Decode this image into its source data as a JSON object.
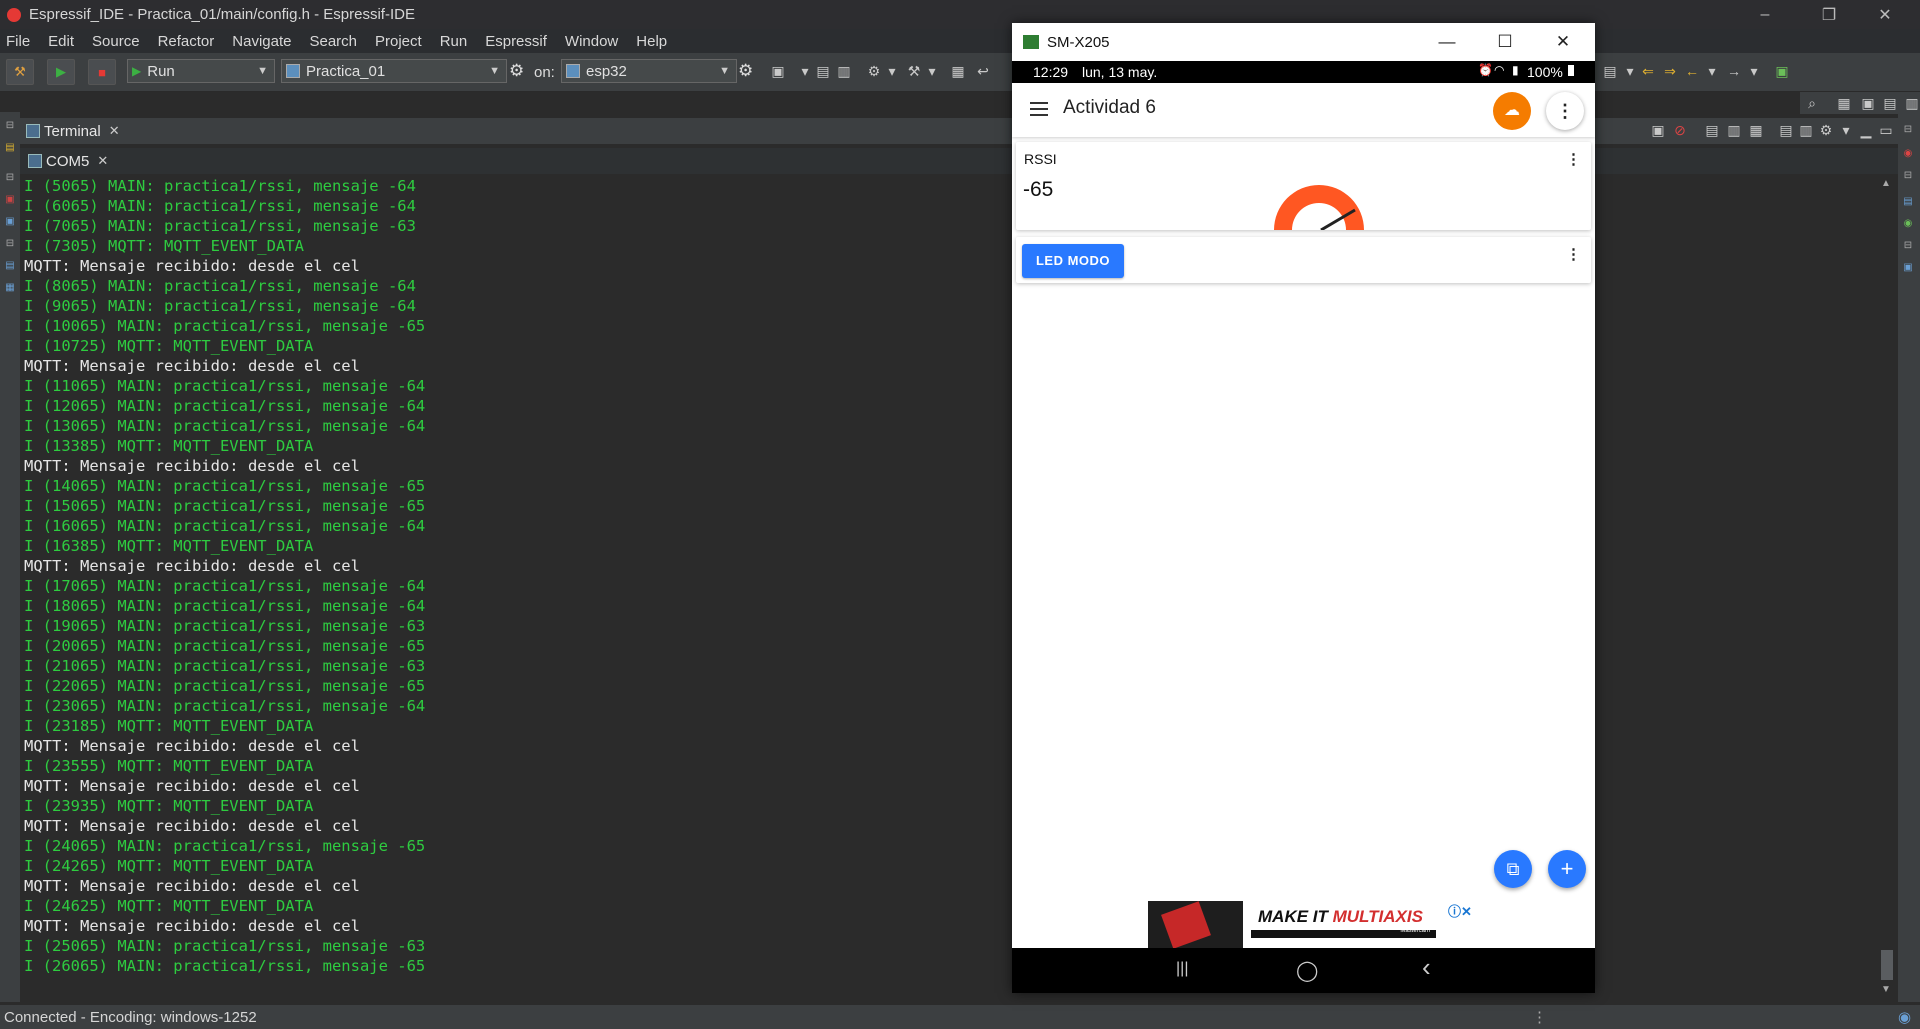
{
  "window": {
    "title": "Espressif_IDE - Practica_01/main/config.h - Espressif-IDE",
    "minimize": "–",
    "maximize": "❐",
    "close": "✕"
  },
  "menu": [
    "File",
    "Edit",
    "Source",
    "Refactor",
    "Navigate",
    "Search",
    "Project",
    "Run",
    "Espressif",
    "Window",
    "Help"
  ],
  "toolbar": {
    "launch_mode": "Run",
    "launch_config": "Practica_01",
    "on_label": "on:",
    "target": "esp32"
  },
  "tabs": {
    "terminal": "Terminal",
    "com": "COM5"
  },
  "console": [
    {
      "text": "I (5065) MAIN: practica1/rssi, mensaje -64",
      "c": "g"
    },
    {
      "text": "I (6065) MAIN: practica1/rssi, mensaje -64",
      "c": "g"
    },
    {
      "text": "I (7065) MAIN: practica1/rssi, mensaje -63",
      "c": "g"
    },
    {
      "text": "I (7305) MQTT: MQTT_EVENT_DATA",
      "c": "g"
    },
    {
      "text": "MQTT: Mensaje recibido: desde el cel",
      "c": "w"
    },
    {
      "text": "I (8065) MAIN: practica1/rssi, mensaje -64",
      "c": "g"
    },
    {
      "text": "I (9065) MAIN: practica1/rssi, mensaje -64",
      "c": "g"
    },
    {
      "text": "I (10065) MAIN: practica1/rssi, mensaje -65",
      "c": "g"
    },
    {
      "text": "I (10725) MQTT: MQTT_EVENT_DATA",
      "c": "g"
    },
    {
      "text": "MQTT: Mensaje recibido: desde el cel",
      "c": "w"
    },
    {
      "text": "I (11065) MAIN: practica1/rssi, mensaje -64",
      "c": "g"
    },
    {
      "text": "I (12065) MAIN: practica1/rssi, mensaje -64",
      "c": "g"
    },
    {
      "text": "I (13065) MAIN: practica1/rssi, mensaje -64",
      "c": "g"
    },
    {
      "text": "I (13385) MQTT: MQTT_EVENT_DATA",
      "c": "g"
    },
    {
      "text": "MQTT: Mensaje recibido: desde el cel",
      "c": "w"
    },
    {
      "text": "I (14065) MAIN: practica1/rssi, mensaje -65",
      "c": "g"
    },
    {
      "text": "I (15065) MAIN: practica1/rssi, mensaje -65",
      "c": "g"
    },
    {
      "text": "I (16065) MAIN: practica1/rssi, mensaje -64",
      "c": "g"
    },
    {
      "text": "I (16385) MQTT: MQTT_EVENT_DATA",
      "c": "g"
    },
    {
      "text": "MQTT: Mensaje recibido: desde el cel",
      "c": "w"
    },
    {
      "text": "I (17065) MAIN: practica1/rssi, mensaje -64",
      "c": "g"
    },
    {
      "text": "I (18065) MAIN: practica1/rssi, mensaje -64",
      "c": "g"
    },
    {
      "text": "I (19065) MAIN: practica1/rssi, mensaje -63",
      "c": "g"
    },
    {
      "text": "I (20065) MAIN: practica1/rssi, mensaje -65",
      "c": "g"
    },
    {
      "text": "I (21065) MAIN: practica1/rssi, mensaje -63",
      "c": "g"
    },
    {
      "text": "I (22065) MAIN: practica1/rssi, mensaje -65",
      "c": "g"
    },
    {
      "text": "I (23065) MAIN: practica1/rssi, mensaje -64",
      "c": "g"
    },
    {
      "text": "I (23185) MQTT: MQTT_EVENT_DATA",
      "c": "g"
    },
    {
      "text": "MQTT: Mensaje recibido: desde el cel",
      "c": "w"
    },
    {
      "text": "I (23555) MQTT: MQTT_EVENT_DATA",
      "c": "g"
    },
    {
      "text": "MQTT: Mensaje recibido: desde el cel",
      "c": "w"
    },
    {
      "text": "I (23935) MQTT: MQTT_EVENT_DATA",
      "c": "g"
    },
    {
      "text": "MQTT: Mensaje recibido: desde el cel",
      "c": "w"
    },
    {
      "text": "I (24065) MAIN: practica1/rssi, mensaje -65",
      "c": "g"
    },
    {
      "text": "I (24265) MQTT: MQTT_EVENT_DATA",
      "c": "g"
    },
    {
      "text": "MQTT: Mensaje recibido: desde el cel",
      "c": "w"
    },
    {
      "text": "I (24625) MQTT: MQTT_EVENT_DATA",
      "c": "g"
    },
    {
      "text": "MQTT: Mensaje recibido: desde el cel",
      "c": "w"
    },
    {
      "text": "I (25065) MAIN: practica1/rssi, mensaje -63",
      "c": "g"
    },
    {
      "text": "I (26065) MAIN: practica1/rssi, mensaje -65",
      "c": "g"
    }
  ],
  "status_bar": {
    "text": "Connected - Encoding: windows-1252"
  },
  "phone": {
    "window_title": "SM-X205",
    "minimize": "—",
    "maximize": "☐",
    "close": "✕",
    "status_time": "12:29",
    "status_date": "lun, 13 may.",
    "battery": "100%",
    "app_title": "Actividad 6",
    "rssi_card": {
      "label": "RSSI",
      "value": "-65",
      "gauge_colors": {
        "arc": "#ff5722",
        "needle": "#222222"
      }
    },
    "led_button": "LED MODO",
    "fab_add": "+",
    "fab_copy": "⧉",
    "ad": {
      "headline_1": "MAKE IT ",
      "headline_2": "MULTIAXIS",
      "brand": "Mastercam",
      "close": "ⓘ✕"
    },
    "nav": {
      "recents": "|||",
      "home": "◯",
      "back": "‹"
    }
  },
  "colors": {
    "console_green": "#2ecc40",
    "console_white": "#e6e6e6",
    "accent_orange": "#f57c00",
    "accent_blue": "#2979ff"
  }
}
